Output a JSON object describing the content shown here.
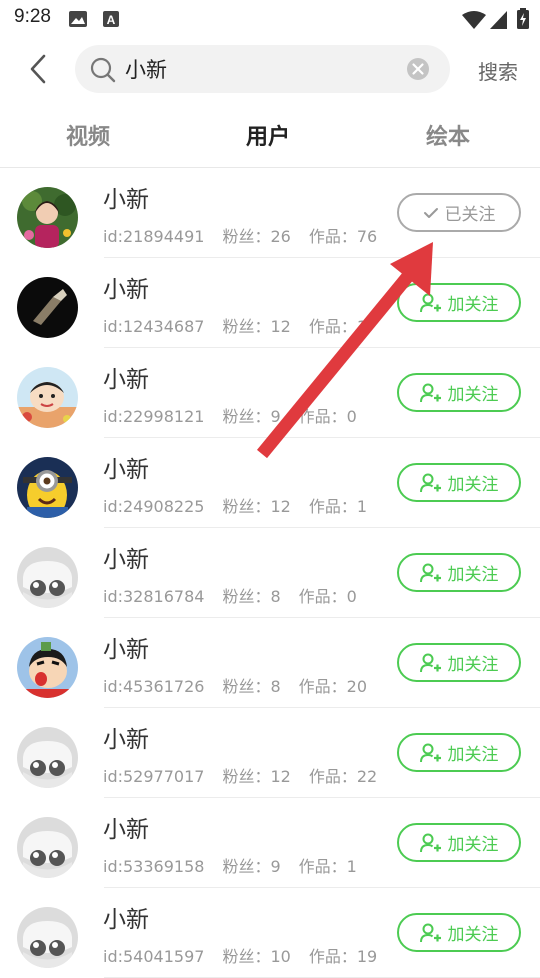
{
  "status_bar": {
    "time": "9:28"
  },
  "search": {
    "query": "小新",
    "action_label": "搜索"
  },
  "tabs": [
    {
      "label": "视频",
      "active": false
    },
    {
      "label": "用户",
      "active": true
    },
    {
      "label": "绘本",
      "active": false
    }
  ],
  "labels": {
    "fans": "粉丝：",
    "works": "作品："
  },
  "users": [
    {
      "name": "小新",
      "id": "id:21894491",
      "fans": "26",
      "works": "76",
      "followed": true,
      "button_label": "已关注",
      "avatar": "girl-photo"
    },
    {
      "name": "小新",
      "id": "id:12434687",
      "fans": "12",
      "works": "1",
      "followed": false,
      "button_label": "加关注",
      "avatar": "dark-photo"
    },
    {
      "name": "小新",
      "id": "id:22998121",
      "fans": "9",
      "works": "0",
      "followed": false,
      "button_label": "加关注",
      "avatar": "cartoon-boy"
    },
    {
      "name": "小新",
      "id": "id:24908225",
      "fans": "12",
      "works": "1",
      "followed": false,
      "button_label": "加关注",
      "avatar": "minion"
    },
    {
      "name": "小新",
      "id": "id:32816784",
      "fans": "8",
      "works": "0",
      "followed": false,
      "button_label": "加关注",
      "avatar": "default"
    },
    {
      "name": "小新",
      "id": "id:45361726",
      "fans": "8",
      "works": "20",
      "followed": false,
      "button_label": "加关注",
      "avatar": "crayon-shin"
    },
    {
      "name": "小新",
      "id": "id:52977017",
      "fans": "12",
      "works": "22",
      "followed": false,
      "button_label": "加关注",
      "avatar": "default"
    },
    {
      "name": "小新",
      "id": "id:53369158",
      "fans": "9",
      "works": "1",
      "followed": false,
      "button_label": "加关注",
      "avatar": "default"
    },
    {
      "name": "小新",
      "id": "id:54041597",
      "fans": "10",
      "works": "19",
      "followed": false,
      "button_label": "加关注",
      "avatar": "default"
    }
  ],
  "colors": {
    "accent": "#4ccb52",
    "followed_border": "#aaaaaa",
    "annotation_arrow": "#e03a3e"
  }
}
